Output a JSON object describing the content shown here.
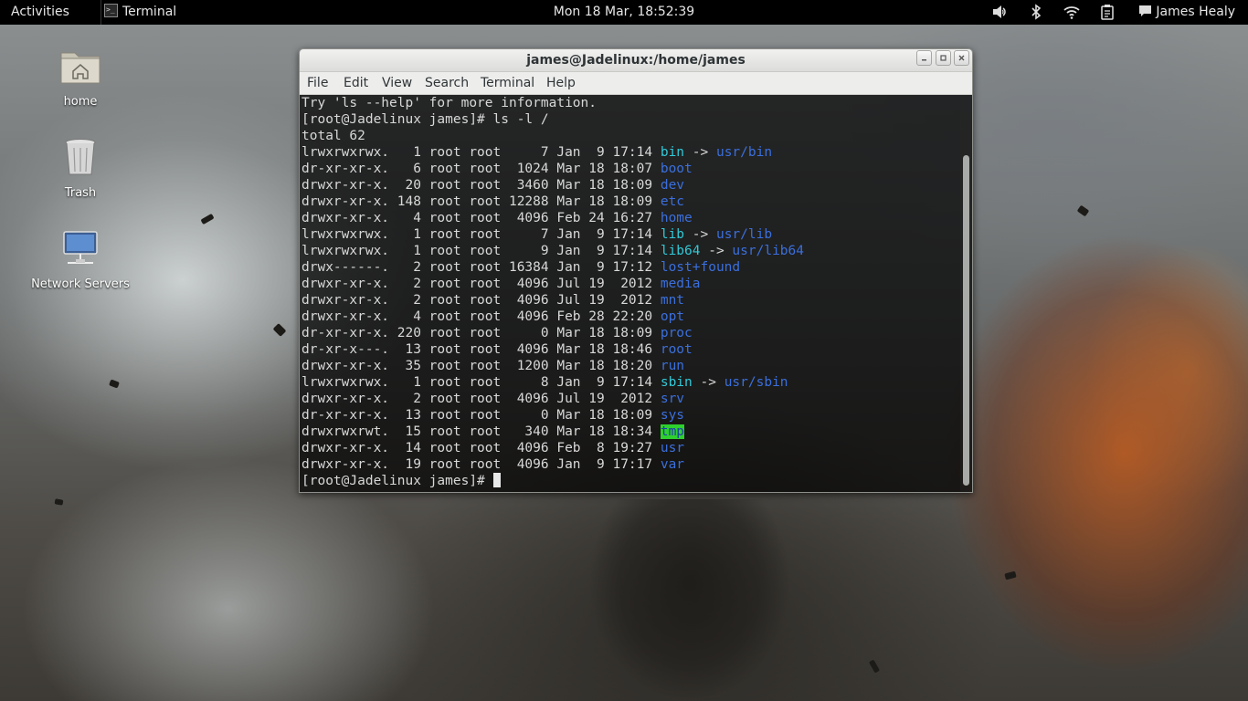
{
  "topbar": {
    "activities": "Activities",
    "app_name": "Terminal",
    "app_icon_glyph": ">_",
    "clock": "Mon 18 Mar, 18:52:39",
    "user": "James Healy",
    "icons": [
      "volume-icon",
      "bluetooth-icon",
      "wifi-icon",
      "clipboard-icon",
      "chat-icon"
    ]
  },
  "desktop": {
    "icons": [
      {
        "label": "home",
        "icon": "home-folder-icon"
      },
      {
        "label": "Trash",
        "icon": "trash-icon"
      },
      {
        "label": "Network Servers",
        "icon": "network-servers-icon"
      }
    ]
  },
  "terminal": {
    "title": "james@Jadelinux:/home/james",
    "menu": [
      "File",
      "Edit",
      "View",
      "Search",
      "Terminal",
      "Help"
    ],
    "colors": {
      "dir": "#3b6fdc",
      "link": "#33c8d6",
      "tmp_bg": "#2ed02e"
    },
    "lines": [
      {
        "pre": "Try 'ls --help' for more information."
      },
      {
        "pre": "[root@Jadelinux james]# ls -l /"
      },
      {
        "pre": "total 62"
      },
      {
        "pre": "lrwxrwxrwx.   1 root root     7 Jan  9 17:14 ",
        "name": "bin",
        "type": "link",
        "target": "usr/bin"
      },
      {
        "pre": "dr-xr-xr-x.   6 root root  1024 Mar 18 18:07 ",
        "name": "boot",
        "type": "dir"
      },
      {
        "pre": "drwxr-xr-x.  20 root root  3460 Mar 18 18:09 ",
        "name": "dev",
        "type": "dir"
      },
      {
        "pre": "drwxr-xr-x. 148 root root 12288 Mar 18 18:09 ",
        "name": "etc",
        "type": "dir"
      },
      {
        "pre": "drwxr-xr-x.   4 root root  4096 Feb 24 16:27 ",
        "name": "home",
        "type": "dir"
      },
      {
        "pre": "lrwxrwxrwx.   1 root root     7 Jan  9 17:14 ",
        "name": "lib",
        "type": "link",
        "target": "usr/lib"
      },
      {
        "pre": "lrwxrwxrwx.   1 root root     9 Jan  9 17:14 ",
        "name": "lib64",
        "type": "link",
        "target": "usr/lib64"
      },
      {
        "pre": "drwx------.   2 root root 16384 Jan  9 17:12 ",
        "name": "lost+found",
        "type": "dir"
      },
      {
        "pre": "drwxr-xr-x.   2 root root  4096 Jul 19  2012 ",
        "name": "media",
        "type": "dir"
      },
      {
        "pre": "drwxr-xr-x.   2 root root  4096 Jul 19  2012 ",
        "name": "mnt",
        "type": "dir"
      },
      {
        "pre": "drwxr-xr-x.   4 root root  4096 Feb 28 22:20 ",
        "name": "opt",
        "type": "dir"
      },
      {
        "pre": "dr-xr-xr-x. 220 root root     0 Mar 18 18:09 ",
        "name": "proc",
        "type": "dir"
      },
      {
        "pre": "dr-xr-x---.  13 root root  4096 Mar 18 18:46 ",
        "name": "root",
        "type": "dir"
      },
      {
        "pre": "drwxr-xr-x.  35 root root  1200 Mar 18 18:20 ",
        "name": "run",
        "type": "dir"
      },
      {
        "pre": "lrwxrwxrwx.   1 root root     8 Jan  9 17:14 ",
        "name": "sbin",
        "type": "link",
        "target": "usr/sbin"
      },
      {
        "pre": "drwxr-xr-x.   2 root root  4096 Jul 19  2012 ",
        "name": "srv",
        "type": "dir"
      },
      {
        "pre": "dr-xr-xr-x.  13 root root     0 Mar 18 18:09 ",
        "name": "sys",
        "type": "dir"
      },
      {
        "pre": "drwxrwxrwt.  15 root root   340 Mar 18 18:34 ",
        "name": "tmp",
        "type": "tmp"
      },
      {
        "pre": "drwxr-xr-x.  14 root root  4096 Feb  8 19:27 ",
        "name": "usr",
        "type": "dir"
      },
      {
        "pre": "drwxr-xr-x.  19 root root  4096 Jan  9 17:17 ",
        "name": "var",
        "type": "dir"
      }
    ],
    "prompt": "[root@Jadelinux james]# "
  }
}
